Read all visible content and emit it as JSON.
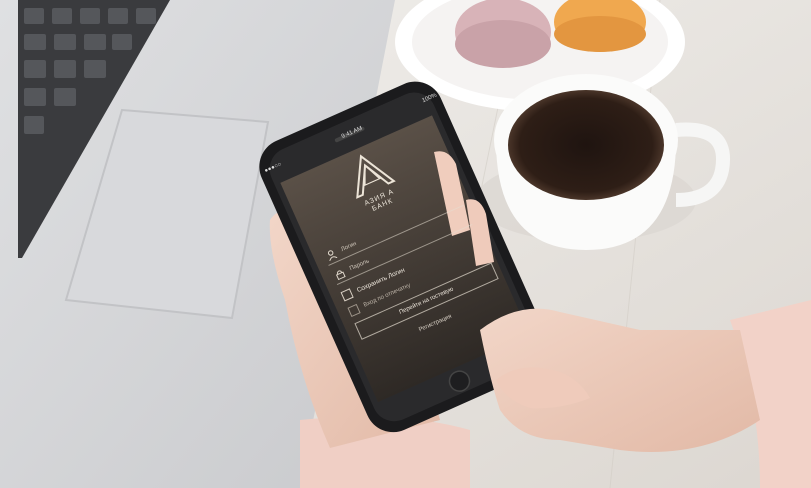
{
  "status_bar": {
    "carrier": "●●●○○",
    "time": "9:41 AM",
    "battery": "100%"
  },
  "bank_logo": {
    "line1": "АЗИЯ А",
    "line2": "БАНК"
  },
  "login_form": {
    "login_placeholder": "Логин",
    "password_placeholder": "Пароль",
    "remember_label": "Сохранить Логин",
    "quick_login_label": "Вход по отпечатку",
    "demo_button": "Перейти на гостевую",
    "register_link": "Регистрация"
  },
  "colors": {
    "screen_bg": "#463f38",
    "text": "#e8e2da"
  }
}
